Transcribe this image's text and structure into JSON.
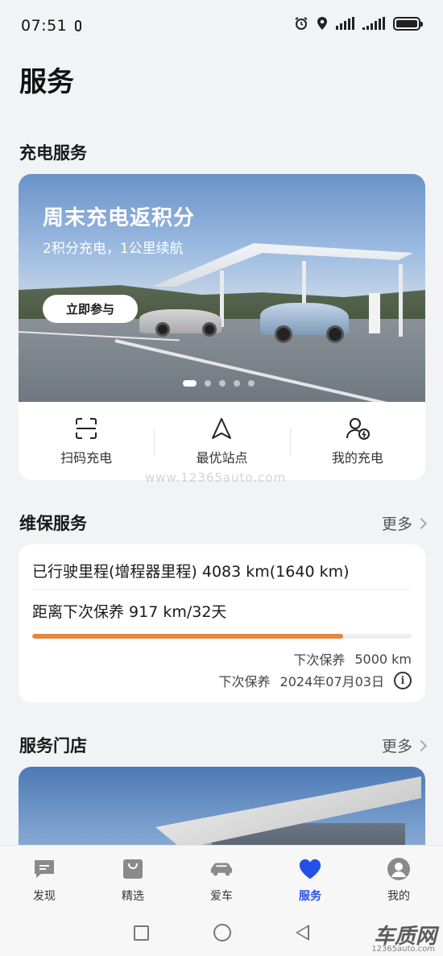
{
  "status": {
    "time": "07:51"
  },
  "page": {
    "title": "服务"
  },
  "charging": {
    "section_title": "充电服务",
    "banner": {
      "headline": "周末充电返积分",
      "subtitle": "2积分充电，1公里续航",
      "button": "立即参与",
      "slides": 5,
      "active_slide": 1
    },
    "quick_actions": [
      {
        "icon": "scan-icon",
        "label": "扫码充电"
      },
      {
        "icon": "navigation-icon",
        "label": "最优站点"
      },
      {
        "icon": "user-charge-icon",
        "label": "我的充电"
      }
    ]
  },
  "maintenance": {
    "section_title": "维保服务",
    "more": "更多",
    "mileage": "已行驶里程(增程器里程) 4083 km(1640 km)",
    "next_distance": "距离下次保养 917 km/32天",
    "progress_fraction": 0.82,
    "progress_color": "#e2893f",
    "next_service_label": "下次保养",
    "next_service_km": "5000 km",
    "next_service_date_label": "下次保养",
    "next_service_date": "2024年07月03日"
  },
  "stores": {
    "section_title": "服务门店",
    "more": "更多"
  },
  "watermark": "www.12365auto.com",
  "tabbar": {
    "active_color": "#2550e6",
    "items": [
      {
        "icon": "discover-icon",
        "label": "发现"
      },
      {
        "icon": "shopping-bag-icon",
        "label": "精选"
      },
      {
        "icon": "car-icon",
        "label": "爱车"
      },
      {
        "icon": "heart-icon",
        "label": "服务"
      },
      {
        "icon": "profile-icon",
        "label": "我的"
      }
    ]
  },
  "corner_logo": {
    "text": "车质网",
    "sub": "12365auto.com"
  }
}
